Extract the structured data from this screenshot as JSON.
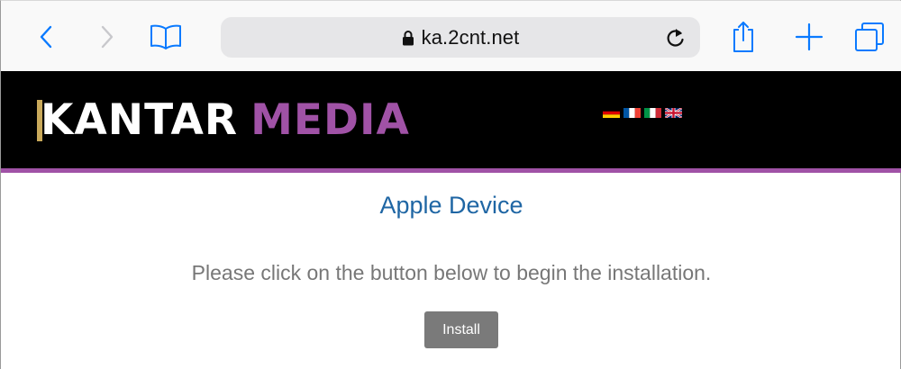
{
  "browser": {
    "url": "ka.2cnt.net",
    "icons": {
      "back": "chevron-left-icon",
      "forward": "chevron-right-icon",
      "bookmarks": "open-book-icon",
      "lock": "lock-icon",
      "reload": "reload-icon",
      "share": "share-icon",
      "new_tab": "plus-icon",
      "tabs": "tabs-icon"
    },
    "accent_color": "#0a7aff"
  },
  "site_header": {
    "logo_part1": "KANTAR",
    "logo_part2": "MEDIA",
    "brand_color": "#a052a6",
    "flags": [
      "de-flag-icon",
      "fr-flag-icon",
      "it-flag-icon",
      "uk-flag-icon"
    ]
  },
  "main": {
    "heading": "Apple Device",
    "instruction": "Please click on the button below to begin the installation.",
    "install_label": "Install"
  }
}
